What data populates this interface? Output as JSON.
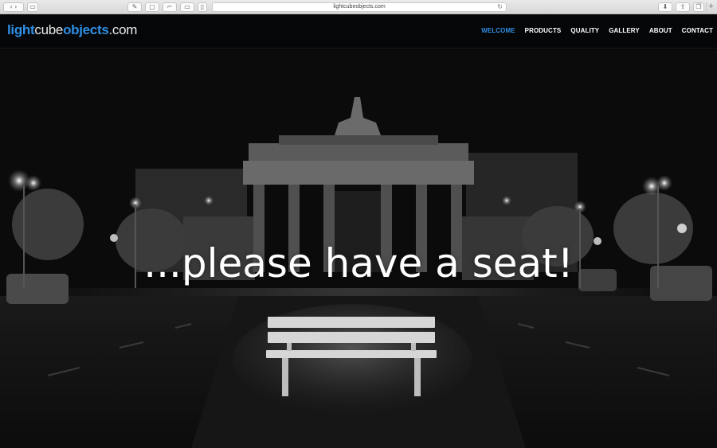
{
  "browser": {
    "url": "lightcubeobjects.com",
    "reload_icon": "reload-icon"
  },
  "site": {
    "logo": {
      "part1": "light",
      "part2": "cube",
      "part3": "objects",
      "part4": ".com"
    },
    "nav": [
      {
        "label": "WELCOME",
        "active": true
      },
      {
        "label": "PRODUCTS",
        "active": false
      },
      {
        "label": "QUALITY",
        "active": false
      },
      {
        "label": "GALLERY",
        "active": false
      },
      {
        "label": "ABOUT",
        "active": false
      },
      {
        "label": "CONTACT",
        "active": false
      }
    ],
    "accent_color": "#2f8fe5"
  },
  "hero": {
    "headline": "...please have a seat!"
  }
}
